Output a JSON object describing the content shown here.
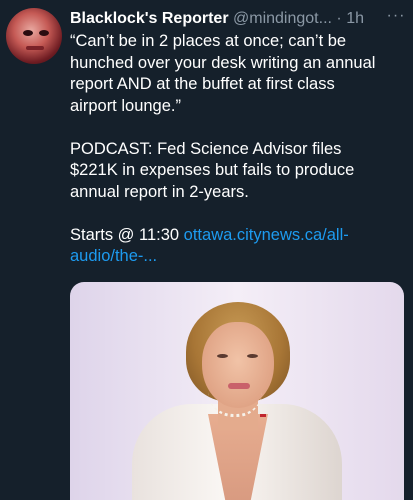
{
  "tweet": {
    "author_name": "Blacklock's Reporter",
    "handle": "@mindingot...",
    "separator": "·",
    "time": "1h",
    "more_label": "···",
    "lines": [
      "“Can’t be in 2 places at once; can’t be",
      "hunched over your desk writing an annual",
      "report AND at the buffet at first class",
      "airport lounge.”"
    ],
    "lines2": [
      "PODCAST:  Fed Science Advisor files",
      "$221K in expenses but fails to produce",
      "annual report in 2-years."
    ],
    "starts_text": "Starts @ 11:30 ",
    "link_part1": "ottawa.citynews.ca/all-",
    "link_part2": "audio/the-..."
  },
  "colors": {
    "background": "#15202b",
    "text": "#ffffff",
    "secondary": "#8b98a5",
    "link": "#1d9bf0"
  }
}
